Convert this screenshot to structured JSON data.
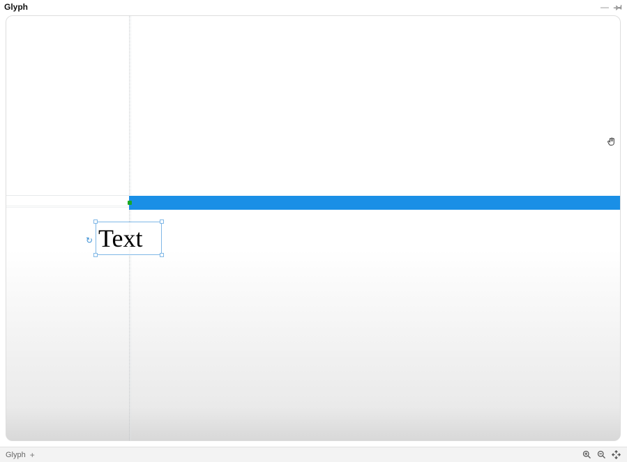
{
  "panel": {
    "title": "Glyph"
  },
  "canvas": {
    "text_content": "Text",
    "blue_bar_color": "#1a8fe6"
  },
  "statusbar": {
    "tab_label": "Glyph",
    "add_tab_label": "+"
  },
  "icons": {
    "minimize": "—",
    "rotate": "↻"
  }
}
